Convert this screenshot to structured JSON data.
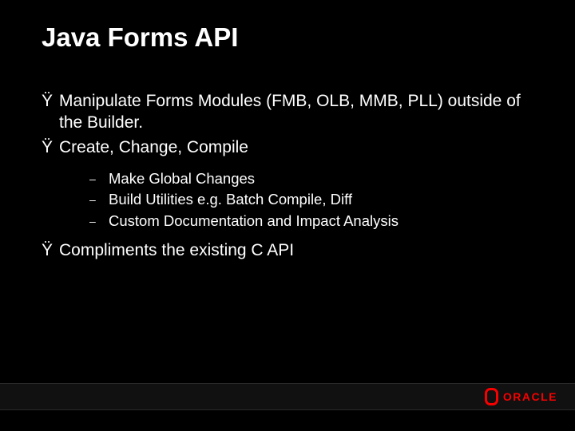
{
  "title": "Java Forms API",
  "bullets": [
    {
      "marker": "Ÿ",
      "text": "Manipulate Forms Modules (FMB, OLB, MMB, PLL) outside of the Builder."
    },
    {
      "marker": "Ÿ",
      "text": "Create, Change, Compile"
    }
  ],
  "sub_bullets": [
    {
      "marker": "–",
      "text": "Make Global Changes"
    },
    {
      "marker": "–",
      "text": "Build Utilities e.g. Batch Compile, Diff"
    },
    {
      "marker": "–",
      "text": "Custom Documentation and Impact Analysis"
    }
  ],
  "last_bullet": {
    "marker": "Ÿ",
    "text": "Compliments the existing C API"
  },
  "logo_text": "ORACLE"
}
